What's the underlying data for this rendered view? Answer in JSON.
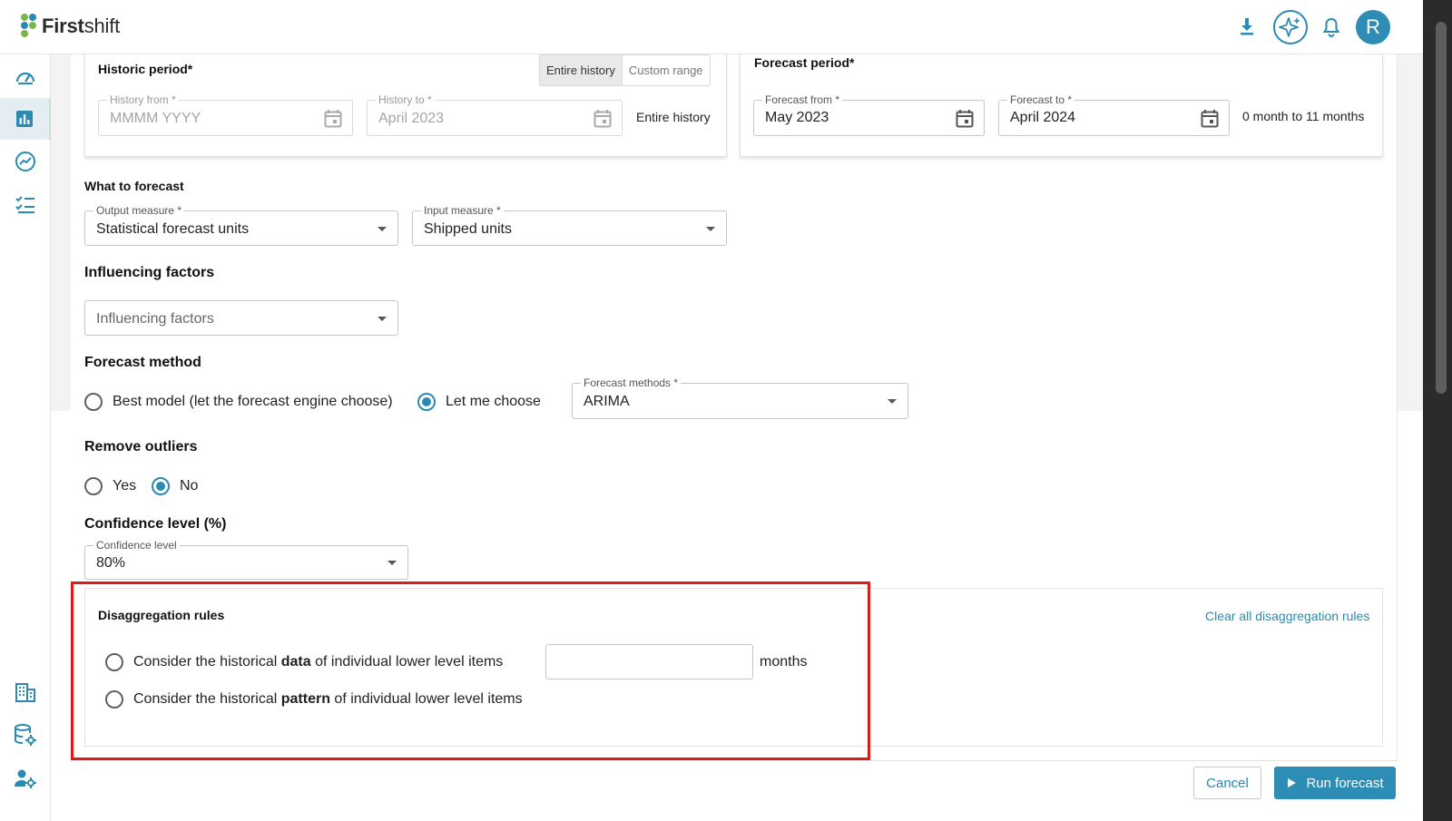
{
  "app": {
    "logo_first": "First",
    "logo_rest": "shift",
    "avatar_letter": "R"
  },
  "colors": {
    "accent": "#2a8ab1",
    "highlight": "#e01919",
    "button": "#2d8db5"
  },
  "topbar": {
    "icons": [
      "download-icon",
      "ai-sparkle-icon",
      "bell-icon"
    ]
  },
  "sidebar": {
    "icons": [
      "dashboard-gauge-icon",
      "bar-chart-icon",
      "trend-icon",
      "checklist-icon",
      "building-icon",
      "database-settings-icon",
      "user-settings-icon"
    ]
  },
  "historic": {
    "title": "Historic period*",
    "toggle": [
      "Entire history",
      "Custom range"
    ],
    "from_label": "History from *",
    "from_placeholder": "MMMM YYYY",
    "to_label": "History to *",
    "to_value": "April 2023",
    "summary": "Entire history"
  },
  "forecast_period": {
    "title": "Forecast period*",
    "from_label": "Forecast from *",
    "from_value": "May 2023",
    "to_label": "Forecast to *",
    "to_value": "April 2024",
    "summary": "0 month to 11 months"
  },
  "what": {
    "title": "What to forecast",
    "output_label": "Output measure *",
    "output_value": "Statistical forecast units",
    "input_label": "Input measure *",
    "input_value": "Shipped units"
  },
  "influencing": {
    "title": "Influencing factors",
    "placeholder": "Influencing factors"
  },
  "method": {
    "title": "Forecast method",
    "opt1": "Best model (let the forecast engine choose)",
    "opt2": "Let me choose",
    "methods_label": "Forecast methods *",
    "methods_value": "ARIMA"
  },
  "outliers": {
    "title": "Remove outliers",
    "yes": "Yes",
    "no": "No"
  },
  "confidence": {
    "title": "Confidence level (%)",
    "label": "Confidence level",
    "value": "80%"
  },
  "disagg": {
    "title": "Disaggregation rules",
    "clear": "Clear all disaggregation rules",
    "opt1_pre": "Consider the historical ",
    "opt1_bold": "data",
    "opt1_post": " of individual lower level items",
    "months": "months",
    "opt2_pre": "Consider the historical ",
    "opt2_bold": "pattern",
    "opt2_post": " of individual lower level items"
  },
  "actions": {
    "cancel": "Cancel",
    "run": "Run forecast"
  }
}
